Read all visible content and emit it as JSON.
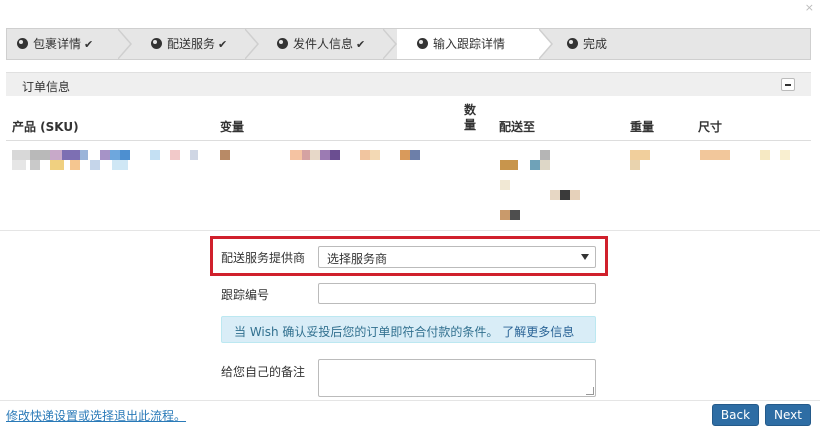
{
  "window": {
    "close_glyph": "×"
  },
  "wizard": {
    "steps": [
      {
        "label": "包裹详情",
        "done_mark": "✔"
      },
      {
        "label": "配送服务",
        "done_mark": "✔"
      },
      {
        "label": "发件人信息",
        "done_mark": "✔"
      },
      {
        "label": "输入跟踪详情",
        "done_mark": ""
      },
      {
        "label": "完成",
        "done_mark": ""
      }
    ]
  },
  "order_panel": {
    "title": "订单信息",
    "collapse_icon": "minus-icon",
    "columns": {
      "product": "产品 (SKU)",
      "variant": "变量",
      "quantity": "数量",
      "ship_to": "配送至",
      "weight": "重量",
      "size": "尺寸"
    }
  },
  "form": {
    "provider_label": "配送服务提供商",
    "provider_value": "选择服务商",
    "tracking_label": "跟踪编号",
    "tracking_value": "",
    "info_text": "当 Wish 确认妥投后您的订单即符合付款的条件。",
    "info_link": "了解更多信息",
    "note_label": "给您自己的备注",
    "note_value": ""
  },
  "footer": {
    "change_link": "修改快递设置或选择退出此流程。",
    "back_label": "Back",
    "next_label": "Next"
  },
  "colors": {
    "accent": "#2e6da4",
    "highlight": "#d0202c",
    "info_bg": "#d9edf7",
    "info_text": "#31708f"
  }
}
